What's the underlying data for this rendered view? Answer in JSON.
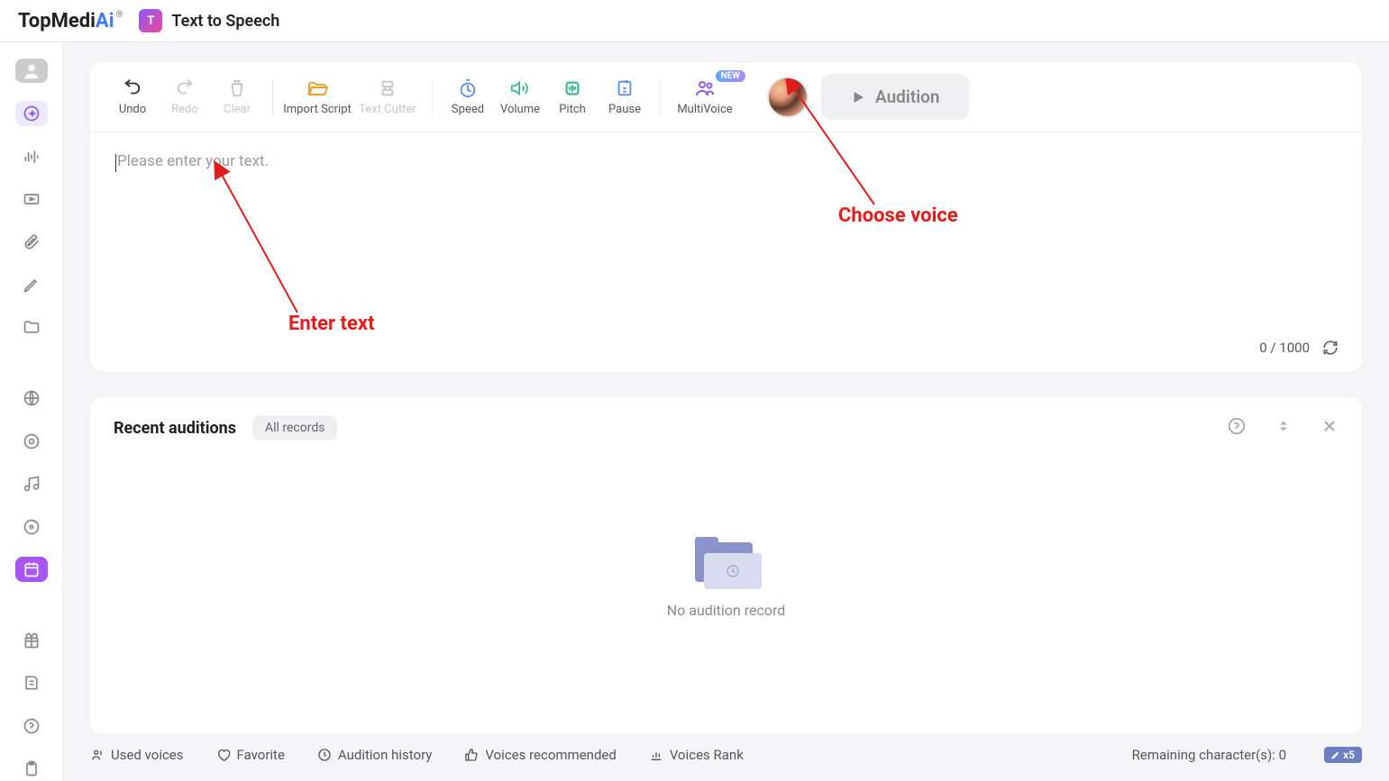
{
  "header": {
    "brand_main": "TopMedi",
    "brand_ai": "Ai",
    "brand_reg": "®",
    "app_name": "Text to Speech",
    "app_badge_text": "T"
  },
  "toolbar": {
    "undo": "Undo",
    "redo": "Redo",
    "clear": "Clear",
    "import_script": "Import Script",
    "text_cutter": "Text Cutter",
    "speed": "Speed",
    "volume": "Volume",
    "pitch": "Pitch",
    "pause": "Pause",
    "multivoice": "MultiVoice",
    "new_badge": "NEW",
    "audition": "Audition"
  },
  "editor": {
    "placeholder": "Please enter your text.",
    "counter": "0 / 1000"
  },
  "auditions": {
    "title": "Recent auditions",
    "filter": "All records",
    "empty": "No audition record"
  },
  "footer": {
    "used_voices": "Used voices",
    "favorite": "Favorite",
    "audition_history": "Audition history",
    "voices_recommended": "Voices recommended",
    "voices_rank": "Voices Rank",
    "remaining": "Remaining character(s): 0",
    "x5": "x5"
  },
  "annotations": {
    "enter_text": "Enter text",
    "choose_voice": "Choose voice"
  }
}
